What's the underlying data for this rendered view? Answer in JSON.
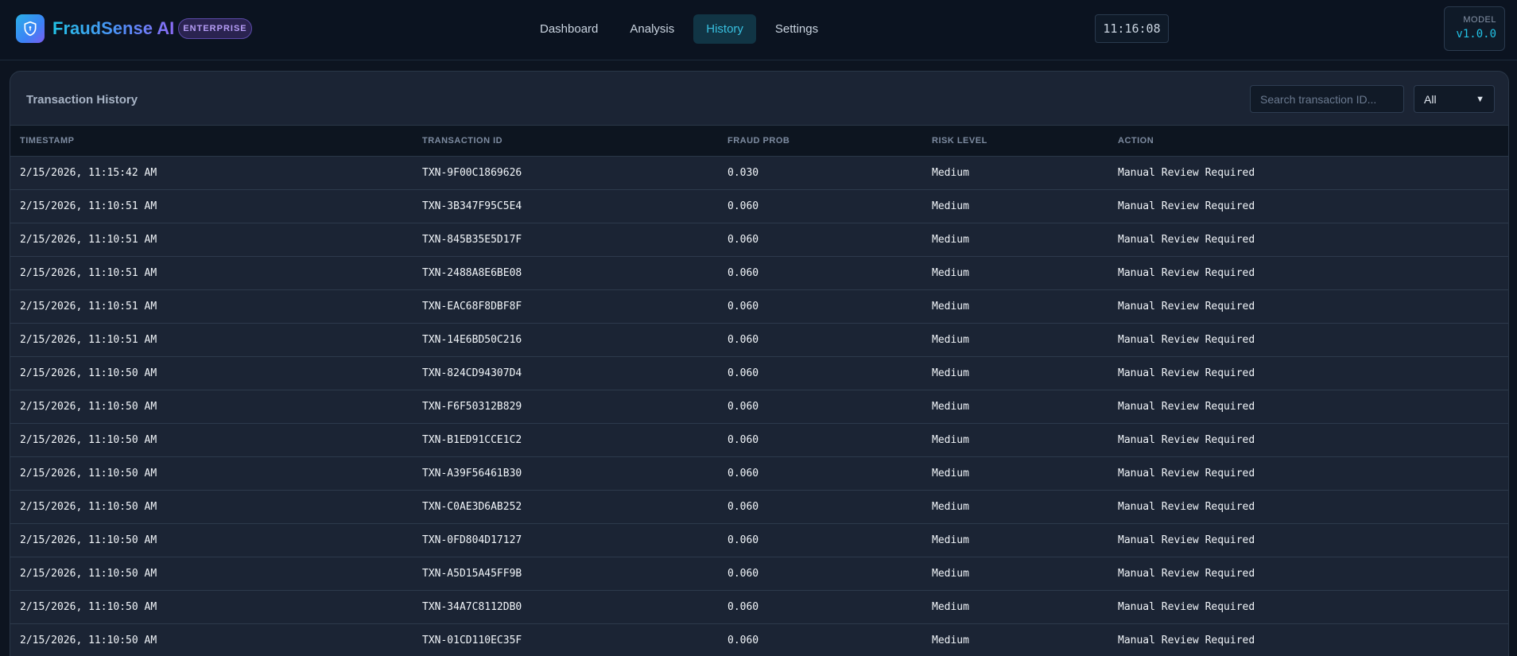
{
  "header": {
    "brand": "FraudSense AI",
    "badge": "ENTERPRISE",
    "nav": [
      "Dashboard",
      "Analysis",
      "History",
      "Settings"
    ],
    "active_nav": "History",
    "clock": "11:16:08",
    "model_label": "MODEL",
    "model_version": "v1.0.0"
  },
  "panel": {
    "title": "Transaction History",
    "search_placeholder": "Search transaction ID...",
    "filter_value": "All",
    "columns": [
      "TIMESTAMP",
      "TRANSACTION ID",
      "FRAUD PROB",
      "RISK LEVEL",
      "ACTION"
    ],
    "rows": [
      [
        "2/15/2026, 11:15:42 AM",
        "TXN-9F00C1869626",
        "0.030",
        "Medium",
        "Manual Review Required"
      ],
      [
        "2/15/2026, 11:10:51 AM",
        "TXN-3B347F95C5E4",
        "0.060",
        "Medium",
        "Manual Review Required"
      ],
      [
        "2/15/2026, 11:10:51 AM",
        "TXN-845B35E5D17F",
        "0.060",
        "Medium",
        "Manual Review Required"
      ],
      [
        "2/15/2026, 11:10:51 AM",
        "TXN-2488A8E6BE08",
        "0.060",
        "Medium",
        "Manual Review Required"
      ],
      [
        "2/15/2026, 11:10:51 AM",
        "TXN-EAC68F8DBF8F",
        "0.060",
        "Medium",
        "Manual Review Required"
      ],
      [
        "2/15/2026, 11:10:51 AM",
        "TXN-14E6BD50C216",
        "0.060",
        "Medium",
        "Manual Review Required"
      ],
      [
        "2/15/2026, 11:10:50 AM",
        "TXN-824CD94307D4",
        "0.060",
        "Medium",
        "Manual Review Required"
      ],
      [
        "2/15/2026, 11:10:50 AM",
        "TXN-F6F50312B829",
        "0.060",
        "Medium",
        "Manual Review Required"
      ],
      [
        "2/15/2026, 11:10:50 AM",
        "TXN-B1ED91CCE1C2",
        "0.060",
        "Medium",
        "Manual Review Required"
      ],
      [
        "2/15/2026, 11:10:50 AM",
        "TXN-A39F56461B30",
        "0.060",
        "Medium",
        "Manual Review Required"
      ],
      [
        "2/15/2026, 11:10:50 AM",
        "TXN-C0AE3D6AB252",
        "0.060",
        "Medium",
        "Manual Review Required"
      ],
      [
        "2/15/2026, 11:10:50 AM",
        "TXN-0FD804D17127",
        "0.060",
        "Medium",
        "Manual Review Required"
      ],
      [
        "2/15/2026, 11:10:50 AM",
        "TXN-A5D15A45FF9B",
        "0.060",
        "Medium",
        "Manual Review Required"
      ],
      [
        "2/15/2026, 11:10:50 AM",
        "TXN-34A7C8112DB0",
        "0.060",
        "Medium",
        "Manual Review Required"
      ],
      [
        "2/15/2026, 11:10:50 AM",
        "TXN-01CD110EC35F",
        "0.060",
        "Medium",
        "Manual Review Required"
      ]
    ]
  }
}
